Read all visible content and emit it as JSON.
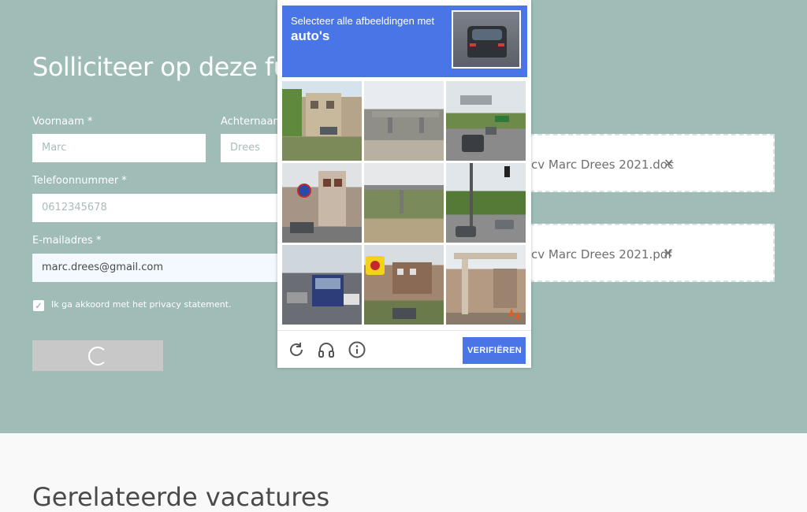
{
  "form": {
    "title": "Solliciteer op deze fu",
    "first_name_label": "Voornaam *",
    "first_name_value": "Marc",
    "last_name_label": "Achternaam",
    "last_name_value": "Drees",
    "phone_label": "Telefoonnummer *",
    "phone_value": "0612345678",
    "email_label": "E-mailadres *",
    "email_value": "marc.drees@gmail.com",
    "privacy_label": "Ik ga akkoord met het privacy statement.",
    "privacy_checked": true
  },
  "uploads": [
    {
      "name": "cv Marc Drees 2021.doc"
    },
    {
      "name": "cv Marc Drees 2021.pdf"
    }
  ],
  "related_title": "Gerelateerde vacatures",
  "captcha": {
    "instruction": "Selecteer alle afbeeldingen met",
    "target": "auto's",
    "verify_label": "VERIFIËREN",
    "footer_icons": [
      "refresh-icon",
      "headphones-icon",
      "info-icon"
    ]
  },
  "colors": {
    "hero_bg": "#9fbcb7",
    "captcha_accent": "#4a75e6"
  }
}
